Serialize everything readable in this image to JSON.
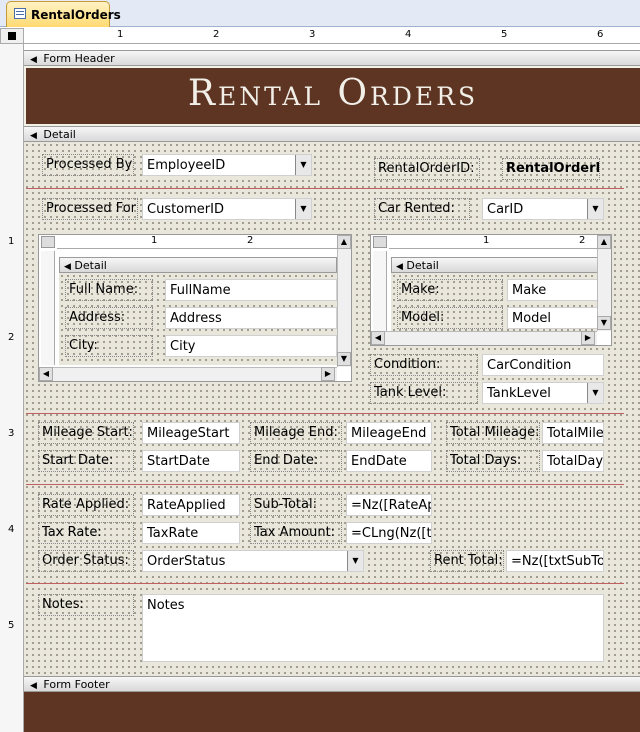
{
  "tab": {
    "label": "RentalOrders",
    "icon": "form-icon"
  },
  "ruler": {
    "h_numbers": [
      "1",
      "2",
      "3",
      "4",
      "5",
      "6"
    ],
    "v_numbers": [
      "1",
      "2",
      "3",
      "4",
      "5"
    ]
  },
  "sections": {
    "header": "Form Header",
    "detail": "Detail",
    "footer": "Form Footer"
  },
  "header": {
    "title": "Rental Orders"
  },
  "detail": {
    "processed_by_label": "Processed By:",
    "processed_by_value": "EmployeeID",
    "rental_order_id_label": "RentalOrderID:",
    "rental_order_id_value": "RentalOrderID",
    "processed_for_label": "Processed For:",
    "processed_for_value": "CustomerID",
    "car_rented_label": "Car Rented:",
    "car_rented_value": "CarID",
    "customer_subform": {
      "section": "Detail",
      "ruler_numbers": [
        "1",
        "2"
      ],
      "fields": [
        {
          "label": "Full Name:",
          "value": "FullName"
        },
        {
          "label": "Address:",
          "value": "Address"
        },
        {
          "label": "City:",
          "value": "City"
        }
      ]
    },
    "car_subform": {
      "section": "Detail",
      "ruler_numbers": [
        "1",
        "2"
      ],
      "fields": [
        {
          "label": "Make:",
          "value": "Make"
        },
        {
          "label": "Model:",
          "value": "Model"
        }
      ]
    },
    "condition_label": "Condition:",
    "condition_value": "CarCondition",
    "tank_level_label": "Tank Level:",
    "tank_level_value": "TankLevel",
    "mileage_start_label": "Mileage Start:",
    "mileage_start_value": "MileageStart",
    "mileage_end_label": "Mileage End:",
    "mileage_end_value": "MileageEnd",
    "total_mileage_label": "Total Mileage:",
    "total_mileage_value": "TotalMile",
    "start_date_label": "Start Date:",
    "start_date_value": "StartDate",
    "end_date_label": "End Date:",
    "end_date_value": "EndDate",
    "total_days_label": "Total Days:",
    "total_days_value": "TotalDays",
    "rate_applied_label": "Rate Applied:",
    "rate_applied_value": "RateApplied",
    "sub_total_label": "Sub-Total:",
    "sub_total_value": "=Nz([RateApp",
    "tax_rate_label": "Tax Rate:",
    "tax_rate_value": "TaxRate",
    "tax_amount_label": "Tax Amount:",
    "tax_amount_value": "=CLng(Nz([txt",
    "order_status_label": "Order Status:",
    "order_status_value": "OrderStatus",
    "rent_total_label": "Rent Total:",
    "rent_total_value": "=Nz([txtSubTot",
    "notes_label": "Notes:",
    "notes_value": "Notes"
  },
  "colors": {
    "brand_brown": "#5d3522",
    "section_grid": "#e9e6dc",
    "separator": "#c06060"
  }
}
